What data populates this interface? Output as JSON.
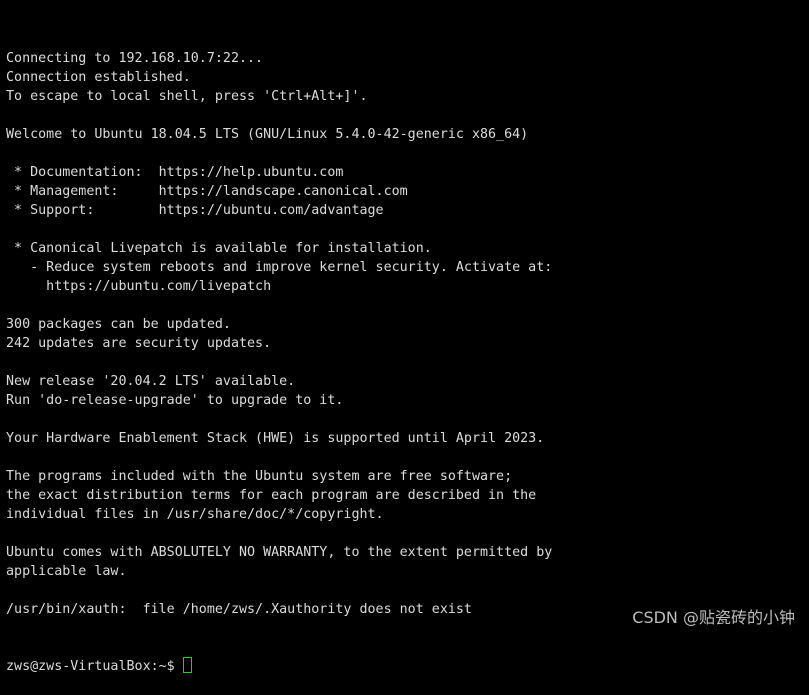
{
  "terminal": {
    "lines": [
      "Connecting to 192.168.10.7:22...",
      "Connection established.",
      "To escape to local shell, press 'Ctrl+Alt+]'.",
      "",
      "Welcome to Ubuntu 18.04.5 LTS (GNU/Linux 5.4.0-42-generic x86_64)",
      "",
      " * Documentation:  https://help.ubuntu.com",
      " * Management:     https://landscape.canonical.com",
      " * Support:        https://ubuntu.com/advantage",
      "",
      " * Canonical Livepatch is available for installation.",
      "   - Reduce system reboots and improve kernel security. Activate at:",
      "     https://ubuntu.com/livepatch",
      "",
      "300 packages can be updated.",
      "242 updates are security updates.",
      "",
      "New release '20.04.2 LTS' available.",
      "Run 'do-release-upgrade' to upgrade to it.",
      "",
      "Your Hardware Enablement Stack (HWE) is supported until April 2023.",
      "",
      "The programs included with the Ubuntu system are free software;",
      "the exact distribution terms for each program are described in the",
      "individual files in /usr/share/doc/*/copyright.",
      "",
      "Ubuntu comes with ABSOLUTELY NO WARRANTY, to the extent permitted by",
      "applicable law.",
      "",
      "/usr/bin/xauth:  file /home/zws/.Xauthority does not exist"
    ],
    "prompt": "zws@zws-VirtualBox:~$",
    "cursor_color": "#1ed21e",
    "text_color": "#dcdcdc",
    "background": "#000000"
  },
  "watermark": "CSDN @贴瓷砖的小钟"
}
